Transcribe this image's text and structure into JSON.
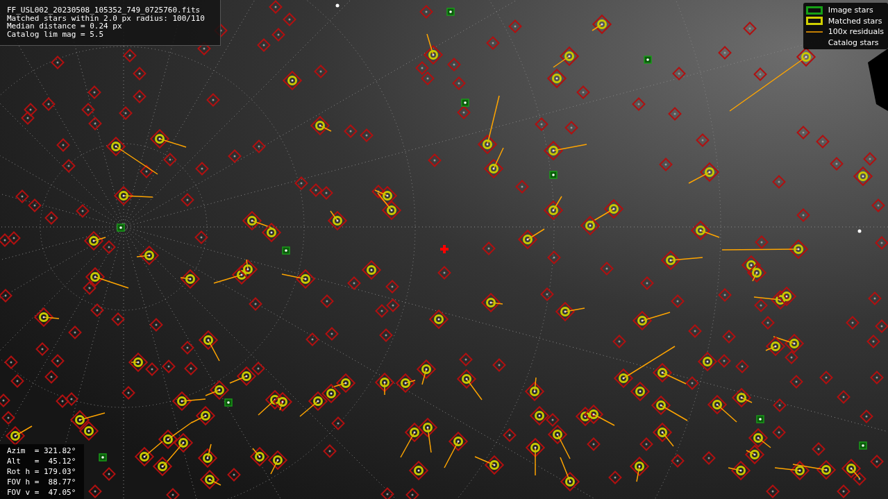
{
  "info_box": {
    "lines": [
      "FF_USL002_20230508_105352_749_0725760.fits",
      "Matched stars within 2.0 px radius: 100/110",
      "Median distance = 0.24 px",
      "Catalog lim mag = 5.5"
    ]
  },
  "legend": [
    {
      "kind": "image",
      "label": "Image stars"
    },
    {
      "kind": "matched",
      "label": "Matched stars"
    },
    {
      "kind": "residual",
      "label": "100x residuals"
    },
    {
      "kind": "catalog",
      "label": "Catalog stars"
    }
  ],
  "readout": [
    "Azim  = 321.82°",
    "Alt   =  45.12°",
    "Rot h = 179.03°",
    "FOV h =  88.77°",
    "FOV v =  47.05°"
  ]
}
